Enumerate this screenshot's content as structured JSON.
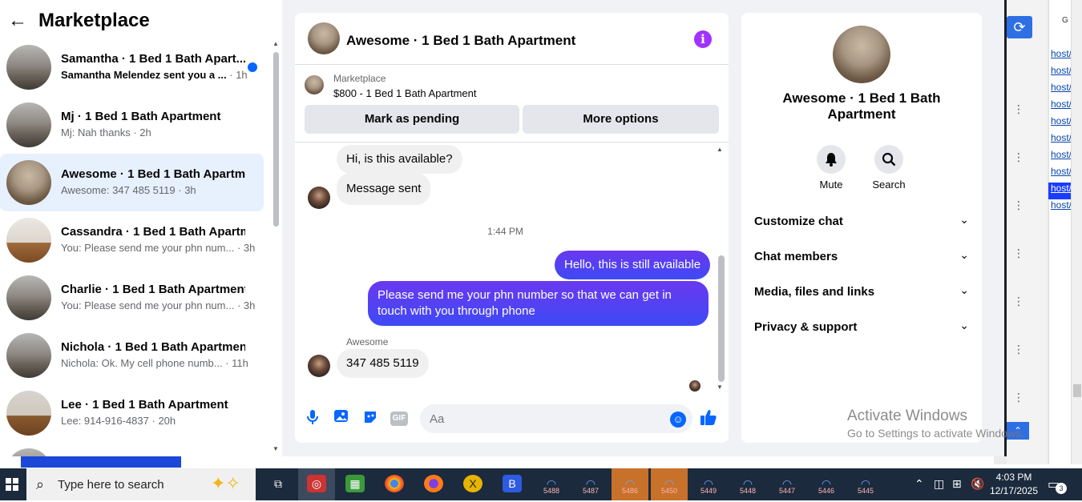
{
  "sidebar": {
    "title": "Marketplace",
    "conversations": [
      {
        "title": "Samantha · 1 Bed 1 Bath Apart...",
        "subtitle": "Samantha Melendez sent you a ...",
        "time": "· 1h",
        "unread": true
      },
      {
        "title": "Mj · 1 Bed 1 Bath Apartment",
        "subtitle": "Mj: Nah thanks",
        "time": "· 2h",
        "unread": false
      },
      {
        "title": "Awesome · 1 Bed 1 Bath Apartm...",
        "subtitle": "Awesome: 347 485 5119",
        "time": "· 3h",
        "unread": false,
        "active": true
      },
      {
        "title": "Cassandra · 1 Bed 1 Bath Apartm...",
        "subtitle": "You: Please send me your phn num...",
        "time": "· 3h",
        "unread": false
      },
      {
        "title": "Charlie · 1 Bed 1 Bath Apartment",
        "subtitle": "You: Please send me your phn num...",
        "time": "· 3h",
        "unread": false
      },
      {
        "title": "Nichola · 1 Bed 1 Bath Apartment",
        "subtitle": "Nichola: Ok. My cell phone numb...",
        "time": "· 11h",
        "unread": false
      },
      {
        "title": "Lee · 1 Bed 1 Bath Apartment",
        "subtitle": "Lee: 914-916-4837",
        "time": "· 20h",
        "unread": false
      }
    ]
  },
  "chat": {
    "title": "Awesome · 1 Bed 1 Bath Apartment",
    "listing": {
      "source": "Marketplace",
      "price_title": "$800 - 1 Bed 1 Bath Apartment",
      "mark_pending_label": "Mark as pending",
      "more_options_label": "More options"
    },
    "messages": {
      "in_1": "Hi, is this available?",
      "in_2": "Message sent",
      "timestamp": "1:44 PM",
      "out_1": "Hello, this is still available",
      "out_2": "Please send me your phn number so that we can get in touch with you through phone",
      "sender_name": "Awesome",
      "in_3": "347 485 5119"
    },
    "composer": {
      "placeholder": "Aa"
    }
  },
  "info_panel": {
    "title": "Awesome · 1 Bed 1 Bath Apartment",
    "mute_label": "Mute",
    "search_label": "Search",
    "sections": [
      "Customize chat",
      "Chat members",
      "Media, files and links",
      "Privacy & support"
    ]
  },
  "watermark": {
    "line1": "Activate Windows",
    "line2": "Go to Settings to activate Windows."
  },
  "background_window": {
    "column_header": "G",
    "link_text": "host/i"
  },
  "taskbar": {
    "search_placeholder": "Type here to search",
    "apps": [
      "5488",
      "5487",
      "5486",
      "5450",
      "5449",
      "5448",
      "5447",
      "5446",
      "5445"
    ],
    "time": "4:03 PM",
    "date": "12/17/2025",
    "notification_count": "3"
  },
  "colors": {
    "accent": "#0866ff",
    "outgoing_bubble": "#4c3bf5",
    "info_icon": "#a033ff",
    "active_conversation": "#e7f0fd"
  }
}
